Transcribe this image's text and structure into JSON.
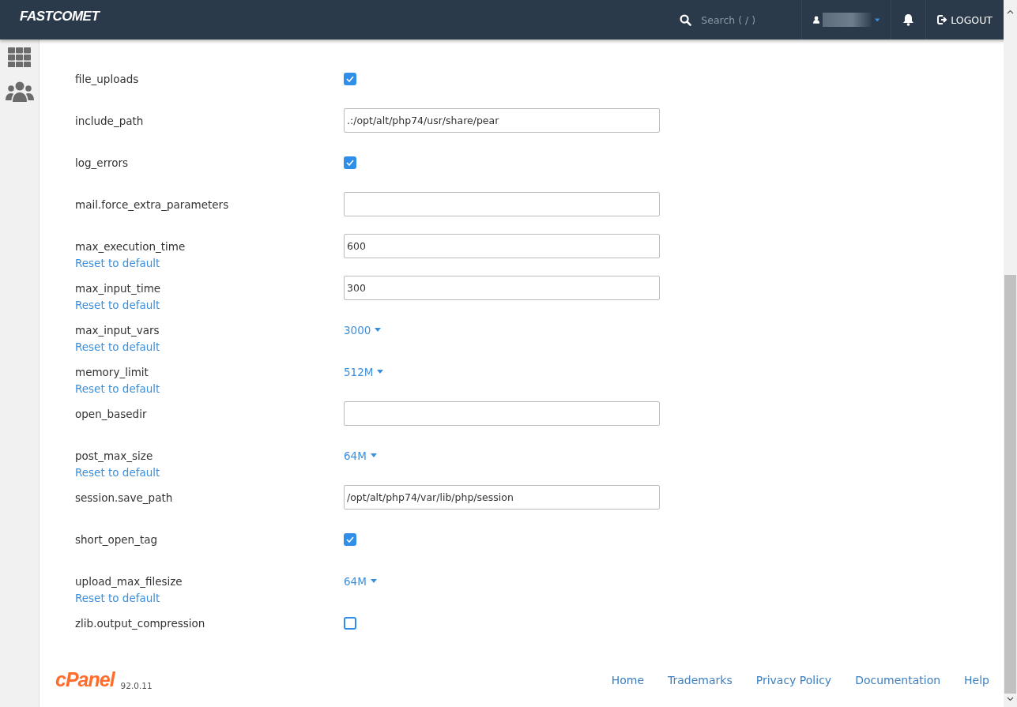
{
  "header": {
    "logo": "FASTCOMET",
    "search": {
      "placeholder": "Search ( / )"
    },
    "logout": "LOGOUT"
  },
  "settings": [
    {
      "name": "file_uploads",
      "kind": "checkbox",
      "checked": true
    },
    {
      "name": "include_path",
      "kind": "text",
      "value": ".:/opt/alt/php74/usr/share/pear"
    },
    {
      "name": "log_errors",
      "kind": "checkbox",
      "checked": true
    },
    {
      "name": "mail.force_extra_parameters",
      "kind": "text"
    },
    {
      "name": "max_execution_time",
      "kind": "text",
      "value": "600",
      "reset": "Reset to default"
    },
    {
      "name": "max_input_time",
      "kind": "text",
      "value": "300",
      "reset": "Reset to default"
    },
    {
      "name": "max_input_vars",
      "kind": "select",
      "value": "3000",
      "reset": "Reset to default"
    },
    {
      "name": "memory_limit",
      "kind": "select",
      "value": "512M",
      "reset": "Reset to default"
    },
    {
      "name": "open_basedir",
      "kind": "text"
    },
    {
      "name": "post_max_size",
      "kind": "select",
      "value": "64M",
      "reset": "Reset to default"
    },
    {
      "name": "session.save_path",
      "kind": "text",
      "value": "/opt/alt/php74/var/lib/php/session"
    },
    {
      "name": "short_open_tag",
      "kind": "checkbox",
      "checked": true
    },
    {
      "name": "upload_max_filesize",
      "kind": "select",
      "value": "64M",
      "reset": "Reset to default"
    },
    {
      "name": "zlib.output_compression",
      "kind": "checkbox",
      "checked": false
    }
  ],
  "footer": {
    "logo": "cPanel",
    "version": "92.0.11",
    "links": [
      "Home",
      "Trademarks",
      "Privacy Policy",
      "Documentation",
      "Help"
    ]
  }
}
